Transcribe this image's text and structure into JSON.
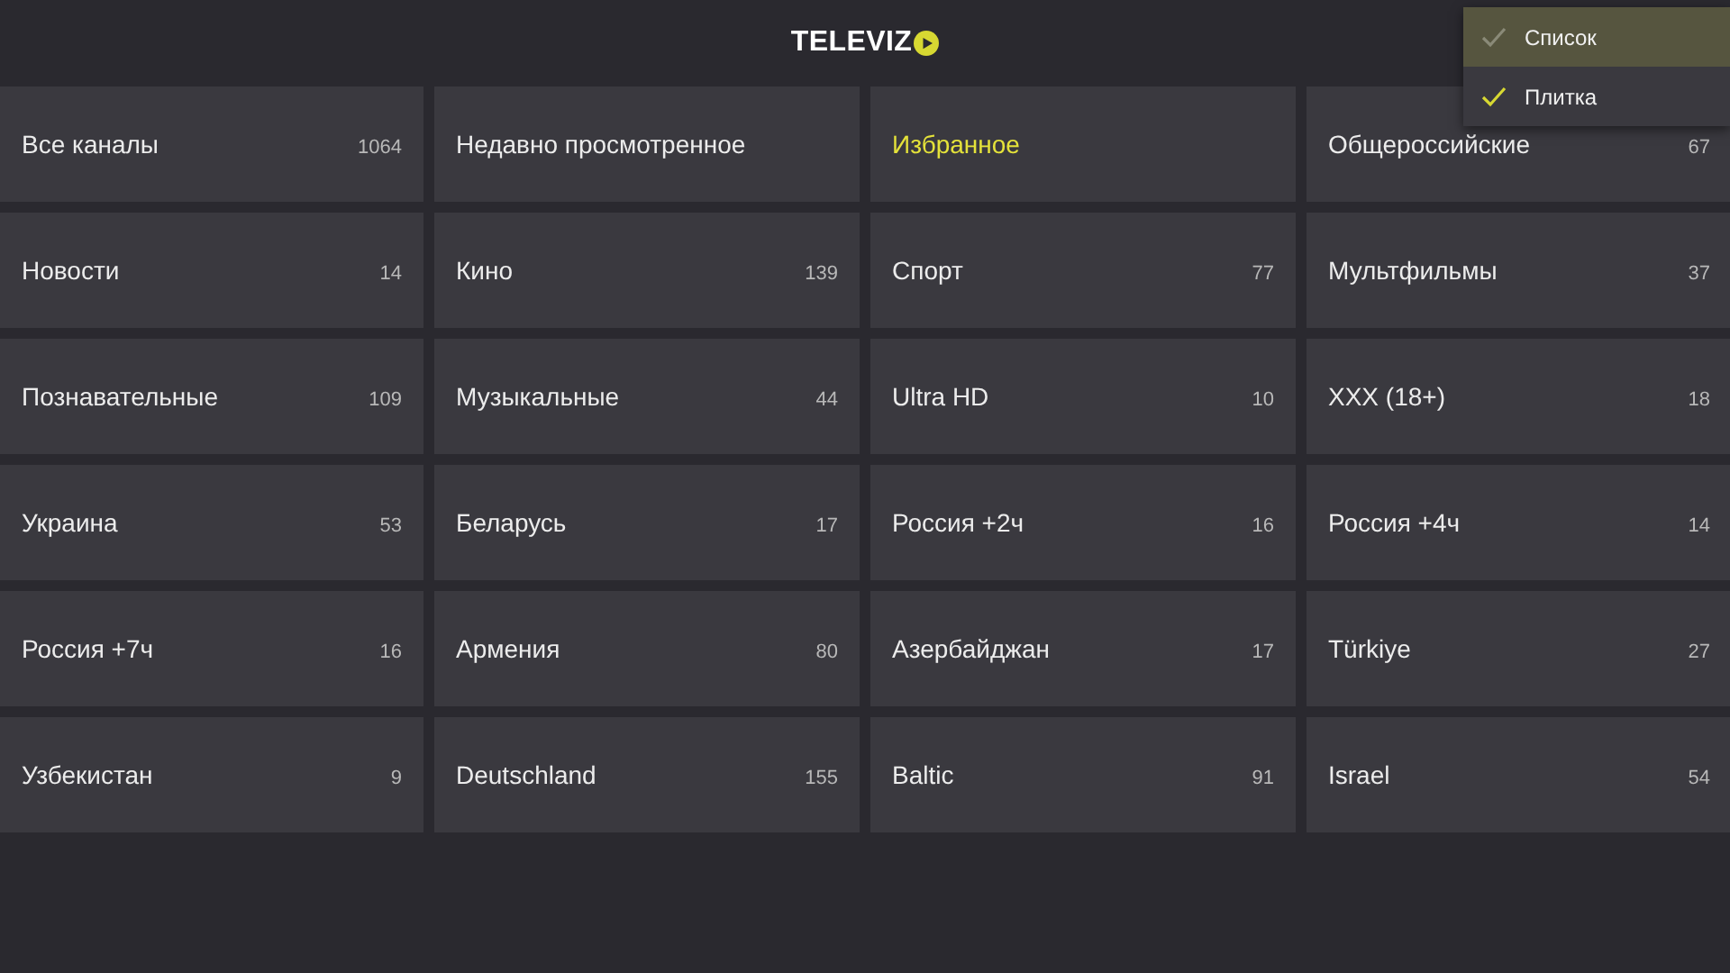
{
  "header": {
    "logo_text": "TELEVIZ"
  },
  "categories": [
    {
      "label": "Все каналы",
      "count": "1064",
      "selected": false
    },
    {
      "label": "Недавно просмотренное",
      "selected": false
    },
    {
      "label": "Избранное",
      "selected": true
    },
    {
      "label": "Общероссийские",
      "count": "67",
      "selected": false
    },
    {
      "label": "Новости",
      "count": "14",
      "selected": false
    },
    {
      "label": "Кино",
      "count": "139",
      "selected": false
    },
    {
      "label": "Спорт",
      "count": "77",
      "selected": false
    },
    {
      "label": "Мультфильмы",
      "count": "37",
      "selected": false
    },
    {
      "label": "Познавательные",
      "count": "109",
      "selected": false
    },
    {
      "label": "Музыкальные",
      "count": "44",
      "selected": false
    },
    {
      "label": "Ultra HD",
      "count": "10",
      "selected": false
    },
    {
      "label": "XXX (18+)",
      "count": "18",
      "selected": false
    },
    {
      "label": "Украина",
      "count": "53",
      "selected": false
    },
    {
      "label": "Беларусь",
      "count": "17",
      "selected": false
    },
    {
      "label": "Россия +2ч",
      "count": "16",
      "selected": false
    },
    {
      "label": "Россия +4ч",
      "count": "14",
      "selected": false
    },
    {
      "label": "Россия +7ч",
      "count": "16",
      "selected": false
    },
    {
      "label": "Армения",
      "count": "80",
      "selected": false
    },
    {
      "label": "Азербайджан",
      "count": "17",
      "selected": false
    },
    {
      "label": "Türkiye",
      "count": "27",
      "selected": false
    },
    {
      "label": "Узбекистан",
      "count": "9",
      "selected": false
    },
    {
      "label": "Deutschland",
      "count": "155",
      "selected": false
    },
    {
      "label": "Baltic",
      "count": "91",
      "selected": false
    },
    {
      "label": "Israel",
      "count": "54",
      "selected": false
    }
  ],
  "view_menu": [
    {
      "label": "Список",
      "selected": true,
      "checked": false
    },
    {
      "label": "Плитка",
      "selected": false,
      "checked": true
    }
  ]
}
